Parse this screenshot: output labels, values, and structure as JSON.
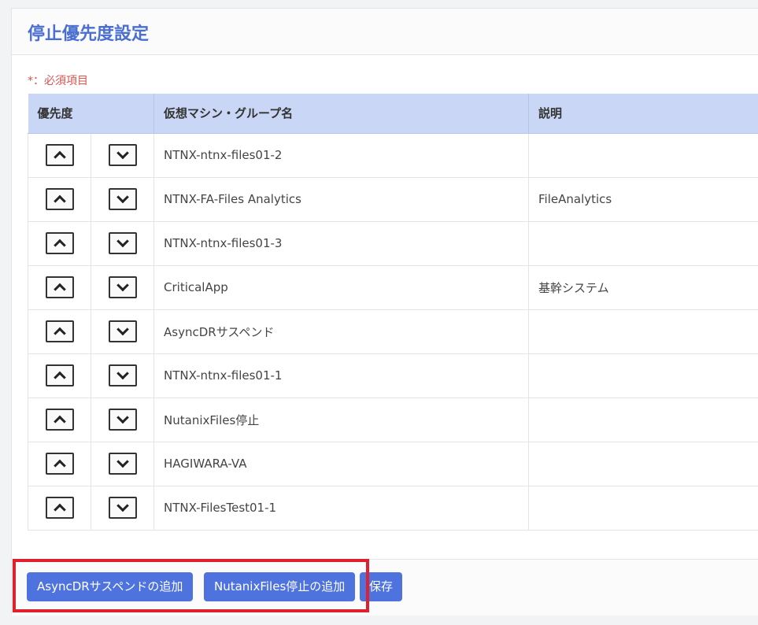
{
  "title": "停止優先度設定",
  "required_note": "*：必須項目",
  "table": {
    "headers": {
      "priority": "優先度",
      "name": "仮想マシン・グループ名",
      "description": "説明"
    },
    "rows": [
      {
        "name": "NTNX-ntnx-files01-2",
        "description": ""
      },
      {
        "name": "NTNX-FA-Files Analytics",
        "description": "FileAnalytics"
      },
      {
        "name": "NTNX-ntnx-files01-3",
        "description": ""
      },
      {
        "name": "CriticalApp",
        "description": "基幹システム"
      },
      {
        "name": "AsyncDRサスペンド",
        "description": ""
      },
      {
        "name": "NTNX-ntnx-files01-1",
        "description": ""
      },
      {
        "name": "NutanixFiles停止",
        "description": ""
      },
      {
        "name": "HAGIWARA-VA",
        "description": ""
      },
      {
        "name": "NTNX-FilesTest01-1",
        "description": ""
      }
    ]
  },
  "footer": {
    "add_async_dr_label": "AsyncDRサスペンドの追加",
    "add_nutanix_files_label": "NutanixFiles停止の追加",
    "save_label": "保存"
  },
  "colors": {
    "accent": "#4e73de",
    "title": "#4a6fd0",
    "header_bg": "#c9d6f5",
    "required": "#d9534f",
    "highlight": "#e0202c"
  }
}
